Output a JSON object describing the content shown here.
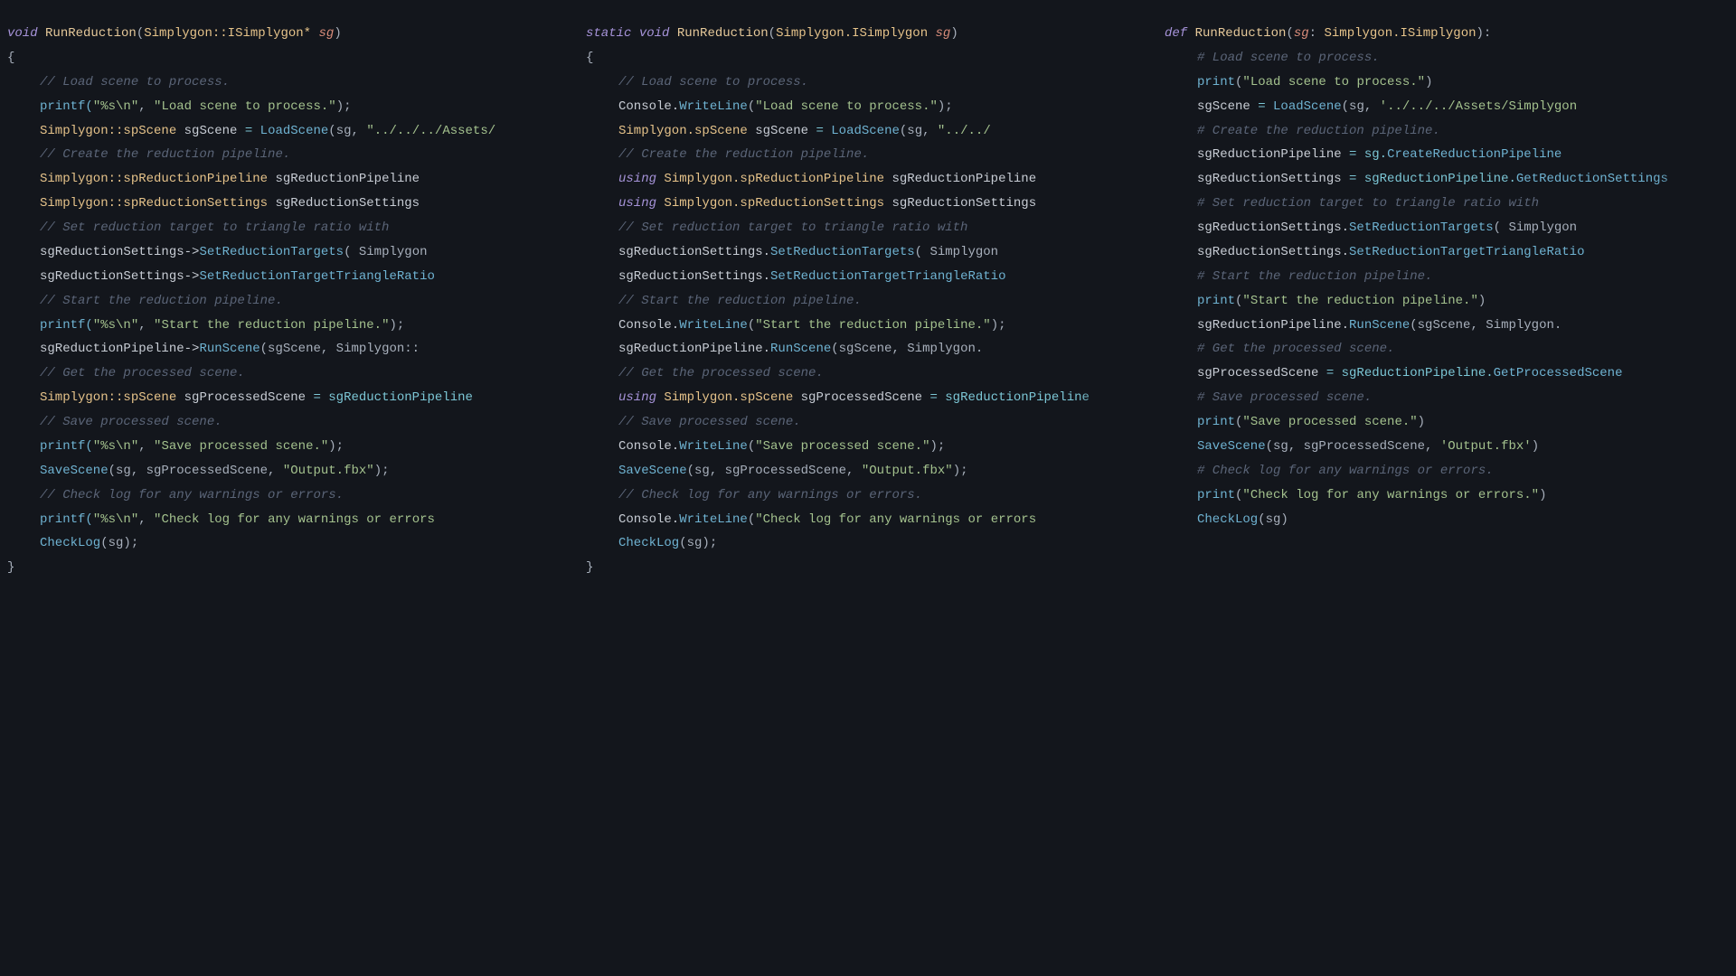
{
  "cpp": {
    "sig_void": "void",
    "sig_fn": "RunReduction",
    "sig_type": "Simplygon::ISimplygon*",
    "sig_param": "sg",
    "comment_load": "// Load scene to process.",
    "printf1a": "printf(",
    "printf1b": "\"%s\\n\"",
    "printf1c": ", ",
    "printf1d": "\"Load scene to process.\"",
    "printf1e": ");",
    "load_type": "Simplygon::spScene",
    "load_var": "sgScene",
    "load_eq": " = ",
    "load_fn": "LoadScene",
    "load_args": "(sg, ",
    "load_str": "\"../../../Assets/",
    "comment_create": "// Create the reduction pipeline.",
    "pipe_type": "Simplygon::spReductionPipeline",
    "pipe_var": "sgReductionPipeline",
    "settings_type": "Simplygon::spReductionSettings",
    "settings_var": "sgReductionSettings",
    "comment_target": "// Set reduction target to triangle ratio with",
    "target1a": "sgReductionSettings->",
    "target1b": "SetReductionTargets",
    "target1c": "( Simplygon",
    "target2a": "sgReductionSettings->",
    "target2b": "SetReductionTargetTriangleRatio",
    "comment_start": "// Start the reduction pipeline.",
    "printf2a": "printf(",
    "printf2b": "\"%s\\n\"",
    "printf2c": ", ",
    "printf2d": "\"Start the reduction pipeline.\"",
    "printf2e": ");",
    "run1a": "sgReductionPipeline->",
    "run1b": "RunScene",
    "run1c": "(sgScene, Simplygon::",
    "comment_get": "// Get the processed scene.",
    "proc_type": "Simplygon::spScene",
    "proc_var": "sgProcessedScene",
    "proc_eq": " = sgReductionPipeline",
    "comment_save": "// Save processed scene.",
    "printf3a": "printf(",
    "printf3b": "\"%s\\n\"",
    "printf3c": ", ",
    "printf3d": "\"Save processed scene.\"",
    "printf3e": ");",
    "save_fn": "SaveScene",
    "save_args": "(sg, sgProcessedScene, ",
    "save_str": "\"Output.fbx\"",
    "save_end": ");",
    "comment_check": "// Check log for any warnings or errors.",
    "printf4a": "printf(",
    "printf4b": "\"%s\\n\"",
    "printf4c": ", ",
    "printf4d": "\"Check log for any warnings or errors",
    "check_fn": "CheckLog",
    "check_args": "(sg);"
  },
  "cs": {
    "sig_static": "static",
    "sig_void": "void",
    "sig_fn": "RunReduction",
    "sig_type": "Simplygon.ISimplygon",
    "sig_param": "sg",
    "comment_load": "// Load scene to process.",
    "write1a": "Console.",
    "write1b": "WriteLine",
    "write1c": "(",
    "write1d": "\"Load scene to process.\"",
    "write1e": ");",
    "load_type": "Simplygon.spScene",
    "load_var": "sgScene",
    "load_eq": " = ",
    "load_fn": "LoadScene",
    "load_args": "(sg, ",
    "load_str": "\"../../",
    "comment_create": "// Create the reduction pipeline.",
    "using": "using",
    "pipe_type": "Simplygon.spReductionPipeline",
    "pipe_var": "sgReductionPipeline",
    "settings_type": "Simplygon.spReductionSettings",
    "settings_var": "sgReductionSettings",
    "comment_target": "// Set reduction target to triangle ratio with",
    "target1a": "sgReductionSettings.",
    "target1b": "SetReductionTargets",
    "target1c": "( Simplygon",
    "target2a": "sgReductionSettings.",
    "target2b": "SetReductionTargetTriangleRatio",
    "comment_start": "// Start the reduction pipeline.",
    "write2a": "Console.",
    "write2b": "WriteLine",
    "write2c": "(",
    "write2d": "\"Start the reduction pipeline.\"",
    "write2e": ");",
    "run1a": "sgReductionPipeline.",
    "run1b": "RunScene",
    "run1c": "(sgScene, Simplygon.",
    "comment_get": "// Get the processed scene.",
    "proc_type": "Simplygon.spScene",
    "proc_var": "sgProcessedScene",
    "proc_eq": " = sgReductionPipeline",
    "comment_save": "// Save processed scene.",
    "write3a": "Console.",
    "write3b": "WriteLine",
    "write3c": "(",
    "write3d": "\"Save processed scene.\"",
    "write3e": ");",
    "save_fn": "SaveScene",
    "save_args": "(sg, sgProcessedScene, ",
    "save_str": "\"Output.fbx\"",
    "save_end": ");",
    "comment_check": "// Check log for any warnings or errors.",
    "write4a": "Console.",
    "write4b": "WriteLine",
    "write4c": "(",
    "write4d": "\"Check log for any warnings or errors",
    "check_fn": "CheckLog",
    "check_args": "(sg);"
  },
  "py": {
    "sig_def": "def",
    "sig_fn": "RunReduction",
    "sig_param": "sg",
    "sig_type": "Simplygon.ISimplygon",
    "comment_load": "# Load scene to process.",
    "print1a": "print",
    "print1b": "(",
    "print1c": "\"Load scene to process.\"",
    "print1d": ")",
    "load_var": "sgScene",
    "load_eq": " = ",
    "load_fn": "LoadScene",
    "load_args": "(sg, ",
    "load_str": "'../../../Assets/Simplygon",
    "comment_create": "# Create the reduction pipeline.",
    "pipe_var": "sgReductionPipeline",
    "pipe_eq": " = sg.",
    "pipe_fn": "CreateReductionPipeline",
    "settings_var": "sgReductionSettings",
    "settings_eq": " = sgReductionPipeline.",
    "settings_fn": "GetReductionSettings",
    "comment_target": "# Set reduction target to triangle ratio with",
    "target1a": "sgReductionSettings.",
    "target1b": "SetReductionTargets",
    "target1c": "( Simplygon",
    "target2a": "sgReductionSettings.",
    "target2b": "SetReductionTargetTriangleRatio",
    "comment_start": "# Start the reduction pipeline.",
    "print2a": "print",
    "print2b": "(",
    "print2c": "\"Start the reduction pipeline.\"",
    "print2d": ")",
    "run1a": "sgReductionPipeline.",
    "run1b": "RunScene",
    "run1c": "(sgScene, Simplygon.",
    "comment_get": "# Get the processed scene.",
    "proc_var": "sgProcessedScene",
    "proc_eq": " = sgReductionPipeline.",
    "proc_fn": "GetProcessedScene",
    "comment_save": "# Save processed scene.",
    "print3a": "print",
    "print3b": "(",
    "print3c": "\"Save processed scene.\"",
    "print3d": ")",
    "save_fn": "SaveScene",
    "save_args": "(sg, sgProcessedScene, ",
    "save_str": "'Output.fbx'",
    "save_end": ")",
    "comment_check": "# Check log for any warnings or errors.",
    "print4a": "print",
    "print4b": "(",
    "print4c": "\"Check log for any warnings or errors.\"",
    "print4d": ")",
    "check_fn": "CheckLog",
    "check_args": "(sg)"
  }
}
